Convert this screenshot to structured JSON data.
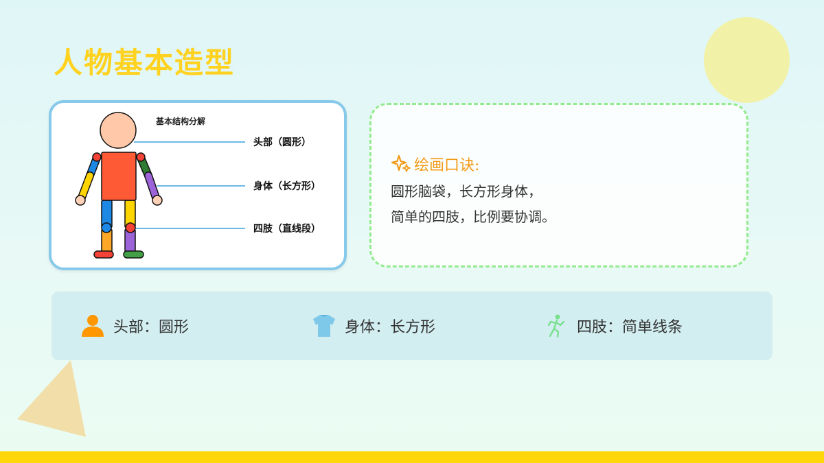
{
  "title": "人物基本造型",
  "figure": {
    "heading": "基本结构分解",
    "labels": {
      "head": "头部（圆形）",
      "body": "身体（长方形）",
      "limbs": "四肢（直线段）"
    }
  },
  "tips": {
    "icon": "sparkle-icon",
    "heading": "绘画口诀:",
    "lines": [
      "圆形脑袋，长方形身体，",
      "简单的四肢，比例要协调。"
    ]
  },
  "summary": [
    {
      "icon": "person-icon",
      "text": "头部：圆形"
    },
    {
      "icon": "shirt-icon",
      "text": "身体：长方形"
    },
    {
      "icon": "running-figure-icon",
      "text": "四肢：简单线条"
    }
  ],
  "colors": {
    "title": "#ffd21f",
    "card_border": "#87c9ea",
    "tips_border": "#92eb8f",
    "tips_heading": "#f39a17",
    "bottom_bar": "#ffd60a"
  }
}
